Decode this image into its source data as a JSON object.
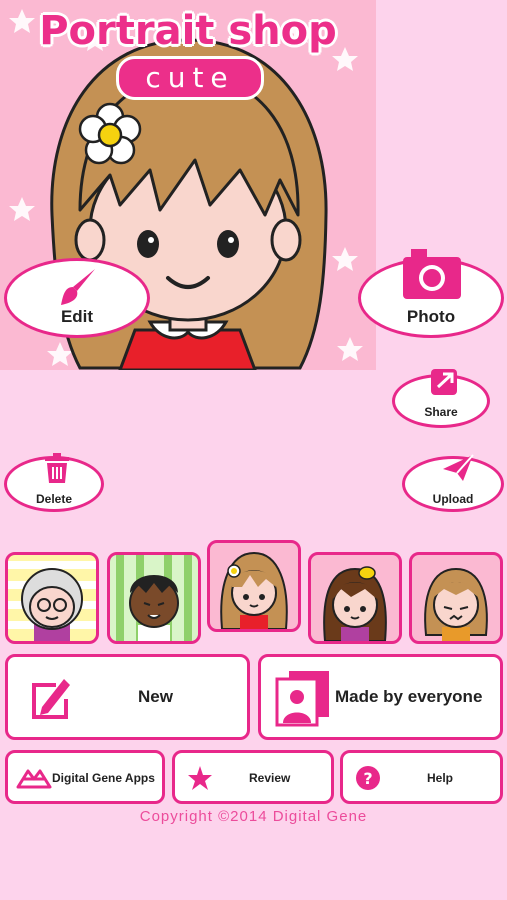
{
  "app": {
    "title": "Portrait shop",
    "subtitle": "cute"
  },
  "actions": {
    "edit": "Edit",
    "photo": "Photo",
    "share": "Share",
    "delete": "Delete",
    "upload": "Upload"
  },
  "thumbnails": [
    {
      "name": "thumb-grandma"
    },
    {
      "name": "thumb-boy"
    },
    {
      "name": "thumb-girl-flower"
    },
    {
      "name": "thumb-girl-brown"
    },
    {
      "name": "thumb-girl-sad"
    }
  ],
  "buttons": {
    "new": "New",
    "made_by_everyone": "Made by everyone",
    "apps": "Digital Gene Apps",
    "review": "Review",
    "help": "Help"
  },
  "footer": {
    "copyright": "Copyright  ©2014 Digital Gene"
  },
  "colors": {
    "background": "#fdd3ec",
    "accent": "#e8288a",
    "hero_bg": "#fbb9d2"
  }
}
